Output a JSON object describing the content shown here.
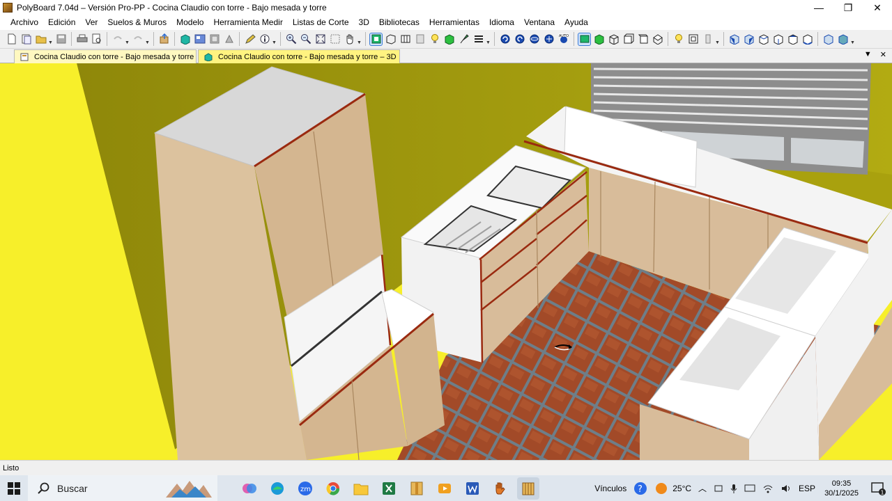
{
  "window": {
    "title": "PolyBoard 7.04d – Versión Pro-PP - Cocina Claudio con torre - Bajo mesada y torre",
    "minimize": "—",
    "maximize": "❐",
    "close": "✕"
  },
  "menu": {
    "items": [
      "Archivo",
      "Edición",
      "Ver",
      "Suelos & Muros",
      "Modelo",
      "Herramienta Medir",
      "Listas de Corte",
      "3D",
      "Bibliotecas",
      "Herramientas",
      "Idioma",
      "Ventana",
      "Ayuda"
    ]
  },
  "tabs": {
    "inactive_label": "Cocina Claudio con torre - Bajo mesada y torre",
    "active_label": "Cocina Claudio con torre - Bajo mesada y torre – 3D",
    "menu_arrow": "▼",
    "close": "✕"
  },
  "status": {
    "text": "Listo"
  },
  "taskbar": {
    "search_label": "Buscar",
    "vinculos": "Vínculos",
    "temperature": "25°C",
    "language": "ESP",
    "time": "09:35",
    "date": "30/1/2025",
    "notification_count": "1",
    "zoom_label": "zm"
  },
  "colors": {
    "wall_left": "#f7ef2a",
    "wall_back": "#a29a0c",
    "floor_tile": "#a24a28",
    "cabinet_wood": "#d8bc9a",
    "accent": "#3a7bd5"
  }
}
